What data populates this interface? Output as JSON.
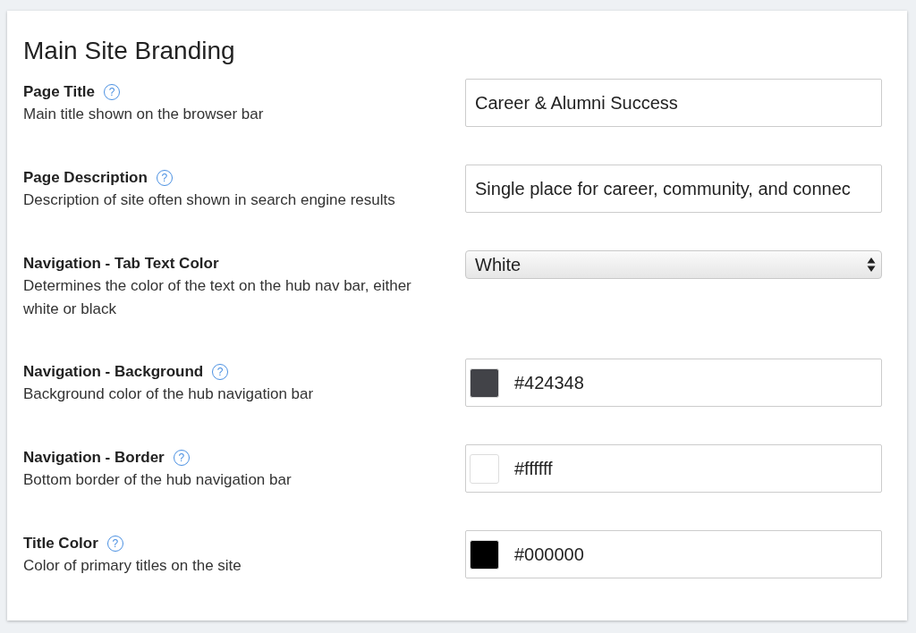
{
  "section": {
    "title": "Main Site Branding"
  },
  "fields": [
    {
      "kind": "text",
      "label": "Page Title",
      "help_icon": "?",
      "description": "Main title shown on the browser bar",
      "value": "Career & Alumni Success"
    },
    {
      "kind": "text",
      "label": "Page Description",
      "help_icon": "?",
      "description": "Description of site often shown in search engine results",
      "value": "Single place for career, community, and connec"
    },
    {
      "kind": "select",
      "label": "Navigation - Tab Text Color",
      "description": "Determines the color of the text on the hub nav bar, either white or black",
      "value": "White"
    },
    {
      "kind": "color",
      "label": "Navigation - Background",
      "help_icon": "?",
      "description": "Background color of the hub navigation bar",
      "value": "#424348",
      "color": "#424348"
    },
    {
      "kind": "color",
      "label": "Navigation - Border",
      "help_icon": "?",
      "description": "Bottom border of the hub navigation bar",
      "value": "#ffffff",
      "color": "#ffffff"
    },
    {
      "kind": "color",
      "label": "Title Color",
      "help_icon": "?",
      "description": "Color of primary titles on the site",
      "value": "#000000",
      "color": "#000000"
    }
  ]
}
